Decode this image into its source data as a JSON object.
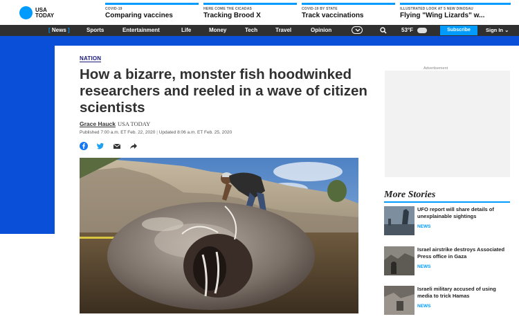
{
  "site": {
    "logo_line1": "USA",
    "logo_line2": "TODAY"
  },
  "trending": [
    {
      "kicker": "COVID-19",
      "headline": "Comparing vaccines"
    },
    {
      "kicker": "HERE COME THE CICADAS",
      "headline": "Tracking Brood X"
    },
    {
      "kicker": "COVID-19 BY STATE",
      "headline": "Track vaccinations"
    },
    {
      "kicker": "ILLUSTRATED LOOK AT 5 NEW DINOSAU",
      "headline": "Flying \"Wing Lizards\" w..."
    }
  ],
  "nav": {
    "items": [
      "News",
      "Sports",
      "Entertainment",
      "Life",
      "Money",
      "Tech",
      "Travel",
      "Opinion"
    ],
    "weather": "53°F",
    "subscribe": "Subscribe",
    "signin": "Sign In"
  },
  "article": {
    "section": "NATION",
    "headline": "How a bizarre, monster fish hoodwinked researchers and reeled in a wave of citizen scientists",
    "author": "Grace Hauck",
    "outlet": "USA TODAY",
    "published": "Published 7:00 a.m. ET Feb. 22, 2020",
    "updated": "Updated 8:06 a.m. ET Feb. 25, 2020"
  },
  "sidebar": {
    "ad_label": "Advertisement",
    "more_stories_title": "More Stories",
    "stories": [
      {
        "title": "UFO report will share details of unexplainable sightings",
        "tag": "NEWS"
      },
      {
        "title": "Israel airstrike destroys Associated Press office in Gaza",
        "tag": "NEWS"
      },
      {
        "title": "Israeli military accused of using media to trick Hamas",
        "tag": "NEWS"
      }
    ]
  },
  "colors": {
    "accent": "#009bff",
    "nav_bg": "#303030",
    "brand_blue": "#0a4fd8"
  },
  "icons": [
    "facebook-icon",
    "twitter-icon",
    "email-icon",
    "share-arrow-icon",
    "search-icon",
    "chevron-down-icon",
    "weather-icon"
  ]
}
